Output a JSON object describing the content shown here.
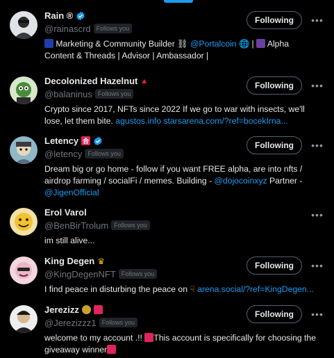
{
  "accounts": [
    {
      "name": "Rain ®",
      "handle": "@rainascrd",
      "follows_you": "Follows you",
      "button": "Following",
      "bio_parts": [
        "Marketing & Community Builder ",
        "@Portalcoin",
        " | ",
        " Alpha Content & Threads | Advisor | Ambassador |"
      ]
    },
    {
      "name": "Decolonized Hazelnut",
      "handle": "@balaninus",
      "follows_you": "Follows you",
      "button": "Following",
      "bio_parts": [
        "Crypto since 2017, NFTs since 2022 If we go to war with insects, we'll lose, let them bite. ",
        "agustos.info",
        " ",
        "starsarena.com/?ref=bocekIrna..."
      ]
    },
    {
      "name": "Letency",
      "name_tag": "合",
      "handle": "@letency",
      "follows_you": "Follows you",
      "button": "Following",
      "bio_parts": [
        "Dream big or go home - follow if you want FREE alpha, are into nfts / airdrop farming / socialFi / memes. Building - ",
        "@dojocoinxyz",
        " Partner - ",
        "@JigenOfficial"
      ]
    },
    {
      "name": "Erol Varol",
      "handle": "@BenBirTrolum",
      "follows_you": "Follows you",
      "button": "Following",
      "bio_parts": [
        "im still alive..."
      ]
    },
    {
      "name": "King Degen",
      "handle": "@KingDegenNFT",
      "follows_you": "Follows you",
      "button": "Following",
      "bio_parts": [
        "I find peace in disturbing the peace on ",
        "arena.social/?ref=KingDegen..."
      ]
    },
    {
      "name": "Jerezizz",
      "handle": "@Jerezizzz1",
      "follows_you": "Follows you",
      "button": "Following",
      "bio_parts": [
        "welcome to my account .!! ",
        "This account is specifically for choosing the giveaway winner"
      ]
    }
  ],
  "colors": {
    "background": "#000000",
    "text": "#e7e9ea",
    "muted": "#71767b",
    "link": "#1d9bf0",
    "verified": "#1d9bf0"
  }
}
